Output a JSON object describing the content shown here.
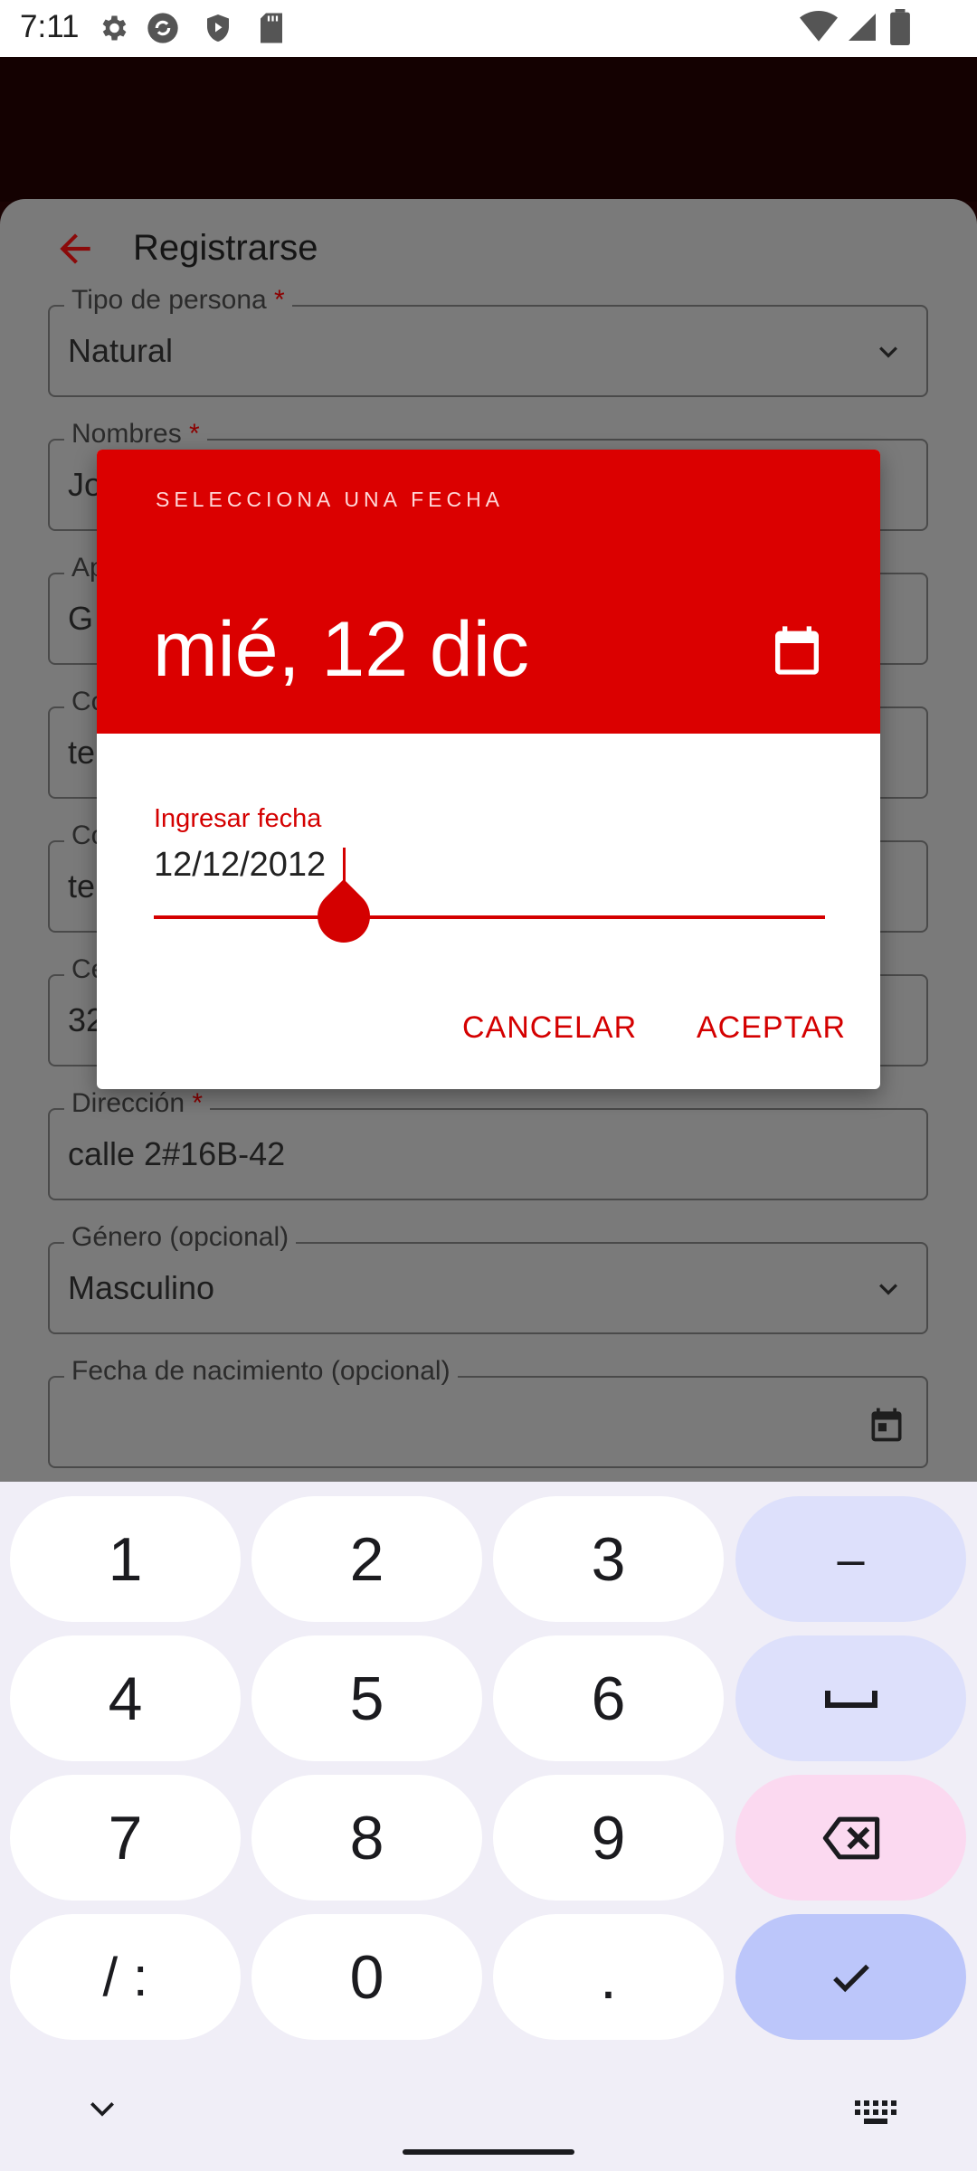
{
  "status_bar": {
    "time": "7:11",
    "icons": [
      "settings-icon",
      "sync-icon",
      "play-protect-icon",
      "sd-card-icon",
      "wifi-icon",
      "signal-icon",
      "battery-icon"
    ]
  },
  "app": {
    "title": "Registrarse",
    "accent_color": "#db0000"
  },
  "form": {
    "fields": [
      {
        "label": "Tipo de persona",
        "required": "*",
        "value": "Natural",
        "type": "select"
      },
      {
        "label": "Nombres",
        "required": "*",
        "value": "Jo"
      },
      {
        "label": "Ap",
        "required": "",
        "value": "G"
      },
      {
        "label": "Co",
        "required": "",
        "value": "te"
      },
      {
        "label": "Co",
        "required": "",
        "value": "te"
      },
      {
        "label": "Ce",
        "required": "",
        "value": "32"
      },
      {
        "label": "Dirección",
        "required": "*",
        "value": "calle 2#16B-42"
      },
      {
        "label": "Género (opcional)",
        "required": "",
        "value": "Masculino",
        "type": "select"
      },
      {
        "label": "Fecha de nacimiento (opcional)",
        "required": "",
        "value": "",
        "type": "date"
      }
    ]
  },
  "dialog": {
    "supertitle": "SELECCIONA UNA FECHA",
    "selected_date": "mié, 12 dic",
    "input_label": "Ingresar fecha",
    "input_value": "12/12/2012",
    "cancel_label": "CANCELAR",
    "accept_label": "ACEPTAR"
  },
  "keyboard": {
    "rows": [
      [
        "1",
        "2",
        "3",
        "–"
      ],
      [
        "4",
        "5",
        "6",
        "space"
      ],
      [
        "7",
        "8",
        "9",
        "backspace"
      ],
      [
        "/ :",
        "0",
        ".",
        "done"
      ]
    ],
    "key_1": "1",
    "key_2": "2",
    "key_3": "3",
    "key_dash": "–",
    "key_4": "4",
    "key_5": "5",
    "key_6": "6",
    "key_7": "7",
    "key_8": "8",
    "key_9": "9",
    "key_slash": "/ :",
    "key_0": "0",
    "key_dot": "."
  }
}
